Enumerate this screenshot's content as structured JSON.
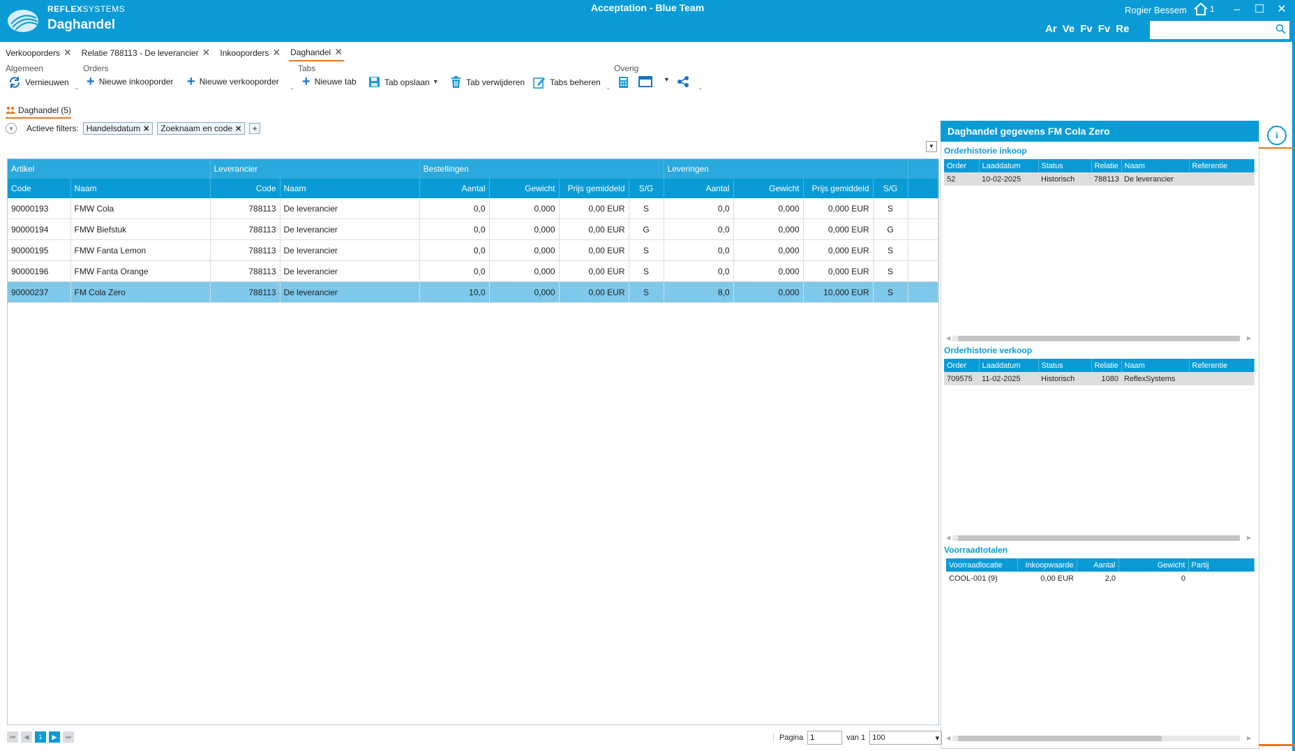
{
  "window": {
    "title": "Acceptation - Blue Team",
    "brand_bold": "REFLEX",
    "brand_thin": "SYSTEMS",
    "app_title": "Daghandel",
    "user": "Rogier Bessem",
    "home_count": "1",
    "quicklinks": [
      "Ar",
      "Ve",
      "Fv",
      "Fv",
      "Re"
    ],
    "search_placeholder": ""
  },
  "doc_tabs": [
    {
      "label": "Verkooporders"
    },
    {
      "label": "Relatie 788113 - De leverancier"
    },
    {
      "label": "Inkooporders"
    },
    {
      "label": "Daghandel",
      "active": true
    }
  ],
  "toolbar": {
    "groups": {
      "algemeen": "Algemeen",
      "orders": "Orders",
      "tabs": "Tabs",
      "overig": "Overig"
    },
    "vernieuwen": "Vernieuwen",
    "nieuwe_inkooporder": "Nieuwe inkooporder",
    "nieuwe_verkooporder": "Nieuwe verkooporder",
    "nieuwe_tab": "Nieuwe tab",
    "tab_opslaan": "Tab opslaan",
    "tab_verwijderen": "Tab verwijderen",
    "tabs_beheren": "Tabs beheren"
  },
  "view_tab": "Daghandel (5)",
  "filters": {
    "label": "Actieve filters:",
    "chips": [
      "Handelsdatum",
      "Zoeknaam en code"
    ]
  },
  "grid": {
    "groups": [
      "Artikel",
      "Leverancier",
      "Bestellingen",
      "Leveringen"
    ],
    "columns": [
      "Code",
      "Naam",
      "Code",
      "Naam",
      "Aantal",
      "Gewicht",
      "Prijs gemiddeld",
      "S/G",
      "Aantal",
      "Gewicht",
      "Prijs gemiddeld",
      "S/G"
    ],
    "rows": [
      [
        "90000193",
        "FMW Cola",
        "788113",
        "De leverancier",
        "0,0",
        "0,000",
        "0,00 EUR",
        "S",
        "0,0",
        "0,000",
        "0,000 EUR",
        "S"
      ],
      [
        "90000194",
        "FMW Biefstuk",
        "788113",
        "De leverancier",
        "0,0",
        "0,000",
        "0,00 EUR",
        "G",
        "0,0",
        "0,000",
        "0,000 EUR",
        "G"
      ],
      [
        "90000195",
        "FMW Fanta Lemon",
        "788113",
        "De leverancier",
        "0,0",
        "0,000",
        "0,00 EUR",
        "S",
        "0,0",
        "0,000",
        "0,000 EUR",
        "S"
      ],
      [
        "90000196",
        "FMW Fanta Orange",
        "788113",
        "De leverancier",
        "0,0",
        "0,000",
        "0,00 EUR",
        "S",
        "0,0",
        "0,000",
        "0,000 EUR",
        "S"
      ],
      [
        "90000237",
        "FM Cola Zero",
        "788113",
        "De leverancier",
        "10,0",
        "0,000",
        "0,00 EUR",
        "S",
        "8,0",
        "0,000",
        "10,000 EUR",
        "S"
      ]
    ],
    "selected_row": 4
  },
  "pager": {
    "current_page": "1",
    "pagina_label": "Pagina",
    "page_value": "1",
    "van_label": "van 1",
    "page_size": "100"
  },
  "panel": {
    "title": "Daghandel gegevens FM Cola Zero",
    "inkoop": {
      "title": "Orderhistorie inkoop",
      "columns": [
        "Order",
        "Laaddatum",
        "Status",
        "Relatie",
        "Naam",
        "Referentie"
      ],
      "rows": [
        [
          "52",
          "10-02-2025",
          "Historisch",
          "788113",
          "De leverancier",
          ""
        ]
      ]
    },
    "verkoop": {
      "title": "Orderhistorie verkoop",
      "columns": [
        "Order",
        "Laaddatum",
        "Status",
        "Relatie",
        "Naam",
        "Referentie"
      ],
      "rows": [
        [
          "709575",
          "11-02-2025",
          "Historisch",
          "1080",
          "ReflexSystems",
          ""
        ]
      ]
    },
    "voorraad": {
      "title": "Voorraadtotalen",
      "columns": [
        "Voorraadlocatie",
        "Inkoopwaarde",
        "Aantal",
        "Gewicht",
        "Partij"
      ],
      "rows": [
        [
          "COOL-001 (9)",
          "0,00 EUR",
          "2,0",
          "0",
          ""
        ]
      ]
    }
  },
  "colors": {
    "accent": "#0a9bd6",
    "orange": "#e87722",
    "selected": "#7ec8ea"
  }
}
